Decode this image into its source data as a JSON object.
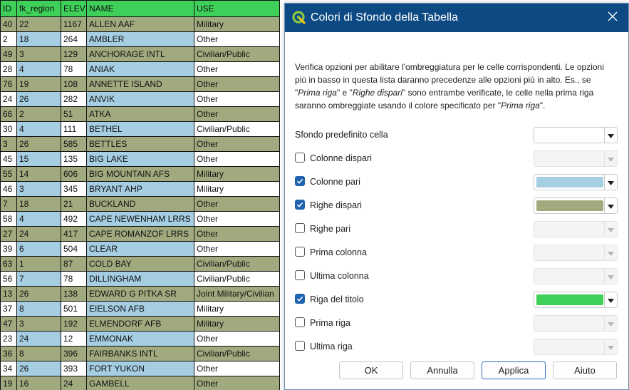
{
  "table": {
    "headers": [
      "ID",
      "fk_region",
      "ELEV",
      "NAME",
      "USE"
    ],
    "rows": [
      [
        "40",
        "22",
        "1167",
        "ALLEN AAF",
        "Military"
      ],
      [
        "2",
        "18",
        "264",
        "AMBLER",
        "Other"
      ],
      [
        "49",
        "3",
        "129",
        "ANCHORAGE INTL",
        "Civilian/Public"
      ],
      [
        "28",
        "4",
        "78",
        "ANIAK",
        "Other"
      ],
      [
        "76",
        "19",
        "108",
        "ANNETTE ISLAND",
        "Other"
      ],
      [
        "24",
        "26",
        "282",
        "ANVIK",
        "Other"
      ],
      [
        "66",
        "2",
        "51",
        "ATKA",
        "Other"
      ],
      [
        "30",
        "4",
        "111",
        "BETHEL",
        "Civilian/Public"
      ],
      [
        "3",
        "26",
        "585",
        "BETTLES",
        "Other"
      ],
      [
        "45",
        "15",
        "135",
        "BIG LAKE",
        "Other"
      ],
      [
        "55",
        "14",
        "606",
        "BIG MOUNTAIN AFS",
        "Military"
      ],
      [
        "46",
        "3",
        "345",
        "BRYANT AHP",
        "Military"
      ],
      [
        "7",
        "18",
        "21",
        "BUCKLAND",
        "Other"
      ],
      [
        "58",
        "4",
        "492",
        "CAPE NEWENHAM LRRS",
        "Other"
      ],
      [
        "27",
        "24",
        "417",
        "CAPE ROMANZOF LRRS",
        "Other"
      ],
      [
        "39",
        "6",
        "504",
        "CLEAR",
        "Other"
      ],
      [
        "63",
        "1",
        "87",
        "COLD BAY",
        "Civilian/Public"
      ],
      [
        "56",
        "7",
        "78",
        "DILLINGHAM",
        "Civilian/Public"
      ],
      [
        "13",
        "26",
        "138",
        "EDWARD G PITKA SR",
        "Joint Military/Civilian"
      ],
      [
        "37",
        "8",
        "501",
        "EIELSON AFB",
        "Military"
      ],
      [
        "47",
        "3",
        "192",
        "ELMENDORF AFB",
        "Military"
      ],
      [
        "23",
        "24",
        "12",
        "EMMONAK",
        "Other"
      ],
      [
        "36",
        "8",
        "396",
        "FAIRBANKS INTL",
        "Civilian/Public"
      ],
      [
        "34",
        "26",
        "393",
        "FORT YUKON",
        "Other"
      ],
      [
        "19",
        "16",
        "24",
        "GAMBELL",
        "Other"
      ]
    ]
  },
  "dialog": {
    "title": "Colori di Sfondo della Tabella",
    "description_parts": [
      "Verifica opzioni per abilitare l'ombreggiatura per le celle corrispondenti. Le opzioni più in basso in questa lista daranno precedenze alle opzioni più in alto. Es., se \"",
      "Prima riga",
      "\" e \"",
      "Righe dispari",
      "\" sono entrambe verificate, le celle nella prima riga saranno ombreggiate usando il colore specificato per \"",
      "Prima riga",
      "\"."
    ],
    "default_bg_label": "Sfondo predefinito cella",
    "options": [
      {
        "label": "Colonne dispari",
        "checked": false,
        "color": ""
      },
      {
        "label": "Colonne pari",
        "checked": true,
        "color": "#a6cee3"
      },
      {
        "label": "Righe dispari",
        "checked": true,
        "color": "#a1aa7e"
      },
      {
        "label": "Righe pari",
        "checked": false,
        "color": ""
      },
      {
        "label": "Prima colonna",
        "checked": false,
        "color": ""
      },
      {
        "label": "Ultima colonna",
        "checked": false,
        "color": ""
      },
      {
        "label": "Riga del titolo",
        "checked": true,
        "color": "#3fd05a"
      },
      {
        "label": "Prima riga",
        "checked": false,
        "color": ""
      },
      {
        "label": "Ultima riga",
        "checked": false,
        "color": ""
      }
    ],
    "buttons": {
      "ok": "OK",
      "cancel": "Annulla",
      "apply": "Applica",
      "help": "Aiuto"
    }
  },
  "colors": {
    "header_bg": "#3fd05a",
    "even_col_bg": "#a6cee3",
    "odd_row_bg": "#a1aa7e",
    "titlebar_bg": "#0d4a84",
    "accent": "#1e62b0"
  }
}
